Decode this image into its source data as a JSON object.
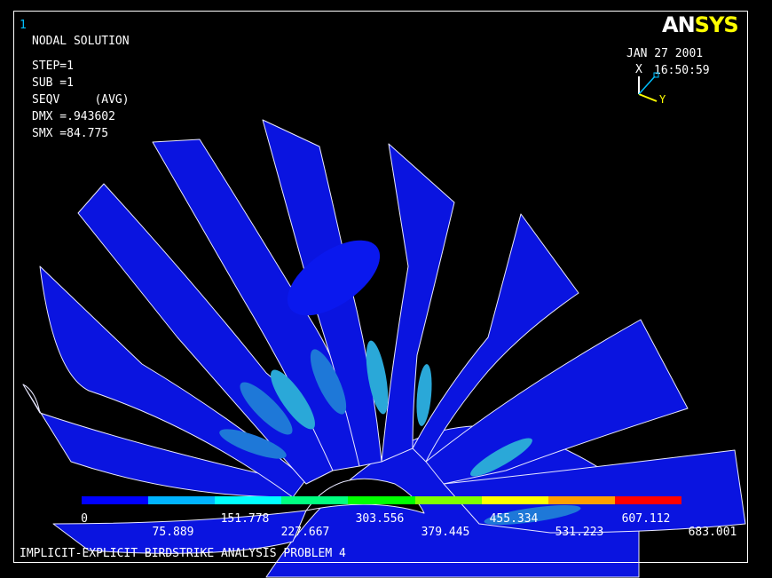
{
  "window_number": "1",
  "logo": {
    "left": "AN",
    "right": "SYS"
  },
  "info": {
    "line1": "NODAL SOLUTION",
    "line2": "STEP=1",
    "line3": "SUB =1",
    "line4": "SEQV     (AVG)",
    "line5": "DMX =.943602",
    "line6": "SMX =84.775"
  },
  "date": "JAN 27 2001",
  "time": "16:50:59",
  "triad": {
    "x_label": "X",
    "y_label": "Y"
  },
  "legend": {
    "colors": [
      "#0000ff",
      "#00b4ff",
      "#00ffff",
      "#00ff80",
      "#00ff00",
      "#80ff00",
      "#ffff00",
      "#ffa000",
      "#ff0000"
    ],
    "labels_top": [
      "0",
      "151.778",
      "303.556",
      "455.334",
      "607.112"
    ],
    "labels_bottom": [
      "75.889",
      "227.667",
      "379.445",
      "531.223",
      "683.001"
    ]
  },
  "title_bottom": "IMPLICIT-EXPLICIT BIRDSTRIKE ANALYSIS PROBLEM 4",
  "colors": {
    "background": "#000000",
    "blade": "#0a14e0",
    "stress_low": "#1e78d8",
    "stress_mid": "#2aa8d8",
    "text": "#ffffff",
    "accent": "#ffff00"
  }
}
